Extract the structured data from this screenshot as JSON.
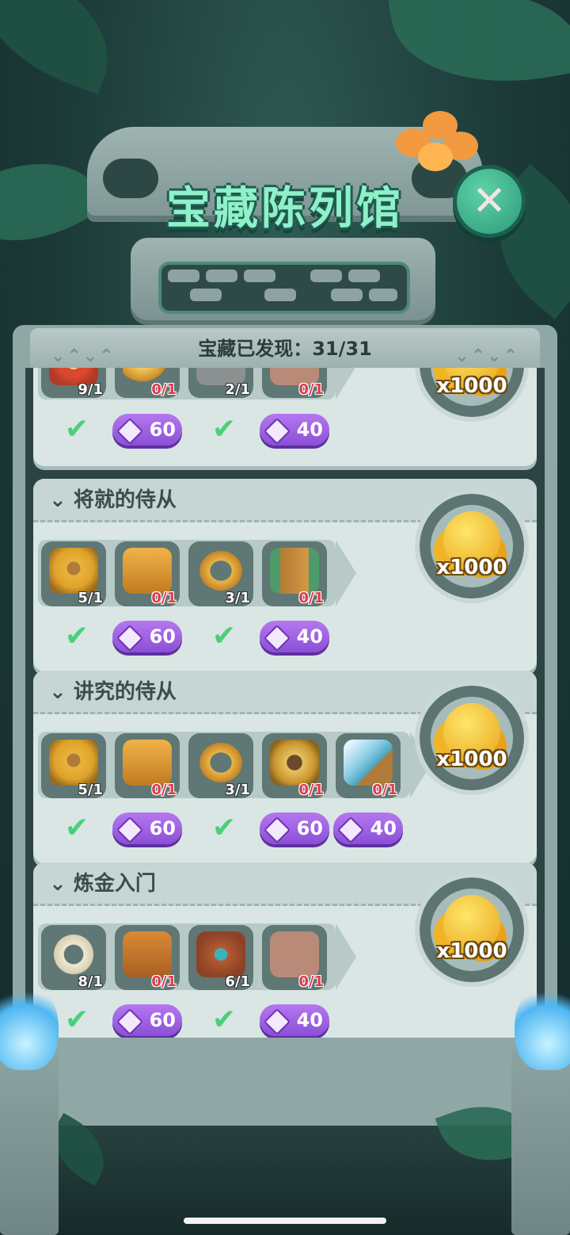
{
  "header": {
    "title": "宝藏陈列馆",
    "close_label": "✕",
    "found_text": "宝藏已发现：31/31"
  },
  "sections": [
    {
      "title": "",
      "items": [
        {
          "icon": "arrow-target-icon",
          "count": "9/1",
          "collected": true,
          "price": ""
        },
        {
          "icon": "bow-icon",
          "count": "0/1",
          "collected": false,
          "price": "60"
        },
        {
          "icon": "serpent-stone-icon",
          "count": "2/1",
          "collected": true,
          "price": ""
        },
        {
          "icon": "stone-tablet-icon",
          "count": "0/1",
          "collected": false,
          "price": "40"
        }
      ],
      "reward": "x1000"
    },
    {
      "title": "将就的侍从",
      "items": [
        {
          "icon": "mouse-shield-icon",
          "count": "5/1",
          "collected": true,
          "price": ""
        },
        {
          "icon": "armor-icon",
          "count": "0/1",
          "collected": false,
          "price": "60"
        },
        {
          "icon": "belt-icon",
          "count": "3/1",
          "collected": true,
          "price": ""
        },
        {
          "icon": "slingshot-icon",
          "count": "0/1",
          "collected": false,
          "price": "40"
        }
      ],
      "reward": "x1000"
    },
    {
      "title": "讲究的侍从",
      "items": [
        {
          "icon": "mouse-shield-icon",
          "count": "5/1",
          "collected": true,
          "price": ""
        },
        {
          "icon": "armor-icon",
          "count": "0/1",
          "collected": false,
          "price": "60"
        },
        {
          "icon": "belt-icon",
          "count": "3/1",
          "collected": true,
          "price": ""
        },
        {
          "icon": "dog-badge-icon",
          "count": "0/1",
          "collected": false,
          "price": "60"
        },
        {
          "icon": "crystal-sword-icon",
          "count": "0/1",
          "collected": false,
          "price": "40"
        }
      ],
      "reward": "x1000"
    },
    {
      "title": "炼金入门",
      "items": [
        {
          "icon": "bone-ring-icon",
          "count": "8/1",
          "collected": true,
          "price": ""
        },
        {
          "icon": "totem-mask-icon",
          "count": "0/1",
          "collected": false,
          "price": "60"
        },
        {
          "icon": "tribal-mask-icon",
          "count": "6/1",
          "collected": true,
          "price": ""
        },
        {
          "icon": "stone-tablet-icon",
          "count": "0/1",
          "collected": false,
          "price": "40"
        }
      ],
      "reward": "x1000"
    }
  ],
  "colors": {
    "accent_green": "#4ccf7a",
    "gem_purple": "#8a4fd6",
    "zero_count_red": "#e03a4a",
    "title_mint": "#8ff0c9"
  }
}
